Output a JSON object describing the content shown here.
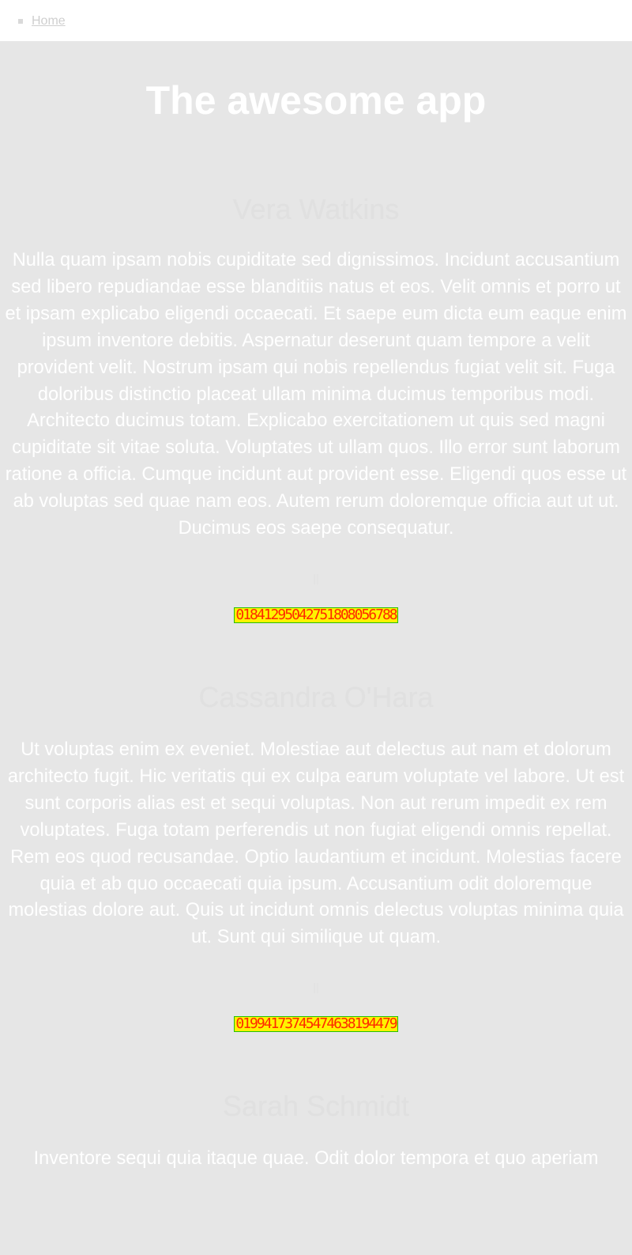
{
  "nav": {
    "items": [
      {
        "label": "Home"
      }
    ]
  },
  "title": "The awesome app",
  "cards": [
    {
      "name": "Vera Watkins",
      "text": "Nulla quam ipsam nobis cupiditate sed dignissimos. Incidunt accusantium sed libero repudiandae esse blanditiis natus et eos. Velit omnis et porro ut et ipsam explicabo eligendi occaecati. Et saepe eum dicta eum eaque enim ipsum inventore debitis. Aspernatur deserunt quam tempore a velit provident velit. Nostrum ipsam qui nobis repellendus fugiat velit sit. Fuga doloribus distinctio placeat ullam minima ducimus temporibus modi. Architecto ducimus totam. Explicabo exercitationem ut quis sed magni cupiditate sit vitae soluta. Voluptates ut ullam quos. Illo error sunt laborum ratione a officia. Cumque incidunt aut provident esse. Eligendi quos esse ut ab voluptas sed quae nam eos. Autem rerum doloremque officia aut ut ut. Ducimus eos saepe consequatur.",
      "divider": "||",
      "code": "01841295042751808056788"
    },
    {
      "name": "Cassandra O'Hara",
      "text": "Ut voluptas enim ex eveniet. Molestiae aut delectus aut nam et dolorum architecto fugit. Hic veritatis qui ex culpa earum voluptate vel labore. Ut est sunt corporis alias est et sequi voluptas. Non aut rerum impedit ex rem voluptates. Fuga totam perferendis ut non fugiat eligendi omnis repellat. Rem eos quod recusandae. Optio laudantium et incidunt. Molestias facere quia et ab quo occaecati quia ipsum. Accusantium odit doloremque molestias dolore aut. Quis ut incidunt omnis delectus voluptas minima quia ut. Sunt qui similique ut quam.",
      "divider": "||",
      "code": "01994173745474638194479"
    },
    {
      "name": "Sarah Schmidt",
      "text": "Inventore sequi quia itaque quae. Odit dolor tempora et quo aperiam"
    }
  ]
}
